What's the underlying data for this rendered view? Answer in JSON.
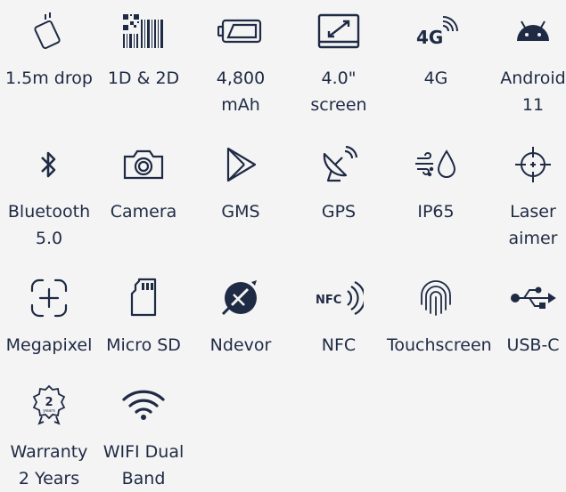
{
  "features": [
    {
      "id": "drop",
      "label": [
        "1.5m drop"
      ],
      "icon": "drop-test-icon"
    },
    {
      "id": "scan",
      "label": [
        "1D & 2D"
      ],
      "icon": "barcode-qr-icon"
    },
    {
      "id": "battery",
      "label": [
        "4,800",
        "mAh"
      ],
      "icon": "battery-icon"
    },
    {
      "id": "screen",
      "label": [
        "4.0\"",
        "screen"
      ],
      "icon": "screen-size-icon"
    },
    {
      "id": "4g",
      "label": [
        "4G"
      ],
      "icon": "4g-signal-icon"
    },
    {
      "id": "android",
      "label": [
        "Android",
        "11"
      ],
      "icon": "android-icon"
    },
    {
      "id": "bluetooth",
      "label": [
        "Bluetooth",
        "5.0"
      ],
      "icon": "bluetooth-icon"
    },
    {
      "id": "camera",
      "label": [
        "Camera"
      ],
      "icon": "camera-icon"
    },
    {
      "id": "gms",
      "label": [
        "GMS"
      ],
      "icon": "play-icon"
    },
    {
      "id": "gps",
      "label": [
        "GPS"
      ],
      "icon": "satellite-dish-icon"
    },
    {
      "id": "ip65",
      "label": [
        "IP65"
      ],
      "icon": "dust-water-icon"
    },
    {
      "id": "laser",
      "label": [
        "Laser",
        "aimer"
      ],
      "icon": "crosshair-icon"
    },
    {
      "id": "megapixel",
      "label": [
        "Megapixel"
      ],
      "icon": "focus-plus-icon"
    },
    {
      "id": "microsd",
      "label": [
        "Micro SD"
      ],
      "icon": "sd-card-icon"
    },
    {
      "id": "ndevor",
      "label": [
        "Ndevor"
      ],
      "icon": "ndevor-logo-icon"
    },
    {
      "id": "nfc",
      "label": [
        "NFC"
      ],
      "icon": "nfc-icon"
    },
    {
      "id": "touch",
      "label": [
        "Touchscreen"
      ],
      "icon": "fingerprint-icon"
    },
    {
      "id": "usbc",
      "label": [
        "USB-C"
      ],
      "icon": "usb-icon"
    },
    {
      "id": "warranty",
      "label": [
        "Warranty",
        "2 Years"
      ],
      "icon": "warranty-badge-icon"
    },
    {
      "id": "wifi",
      "label": [
        "WIFI Dual",
        "Band"
      ],
      "icon": "wifi-icon"
    }
  ],
  "badge_text": {
    "number": "2",
    "unit": "years"
  },
  "icon_text": {
    "g4": "4G",
    "nfc": "NFC"
  },
  "colors": {
    "icon": "#1f2a44",
    "background": "#f4f4f4"
  }
}
